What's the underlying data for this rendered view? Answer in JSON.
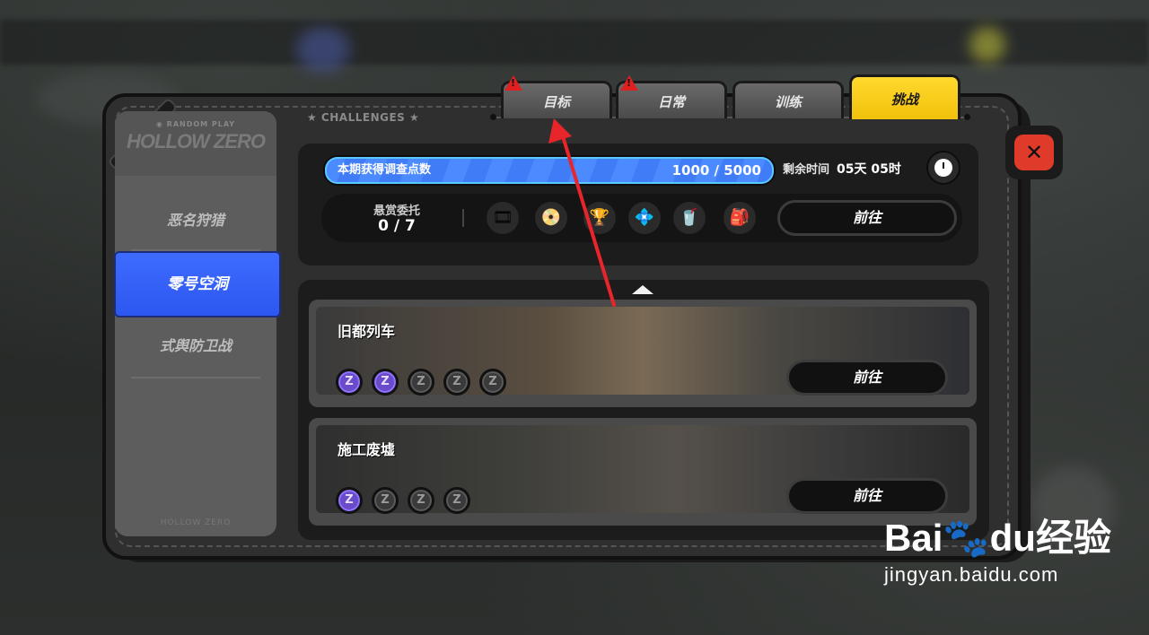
{
  "header": {
    "section_label": "★ CHALLENGES ★"
  },
  "tabs": [
    {
      "label": "目标",
      "alert": true,
      "active": false
    },
    {
      "label": "日常",
      "alert": true,
      "active": false
    },
    {
      "label": "训练",
      "alert": false,
      "active": false
    },
    {
      "label": "挑战",
      "alert": false,
      "active": true
    }
  ],
  "alert_glyph": "!",
  "sidebar": {
    "brand_small": "◉ RANDOM PLAY",
    "brand": "HOLLOW ZERO",
    "items": [
      {
        "label": "恶名狩猎",
        "active": false
      },
      {
        "label": "零号空洞",
        "active": true
      },
      {
        "label": "式舆防卫战",
        "active": false
      }
    ],
    "footer": "HOLLOW ZERO"
  },
  "progress": {
    "label": "本期获得调查点数",
    "value_text": "1000 / 5000",
    "fraction": 1.0
  },
  "remaining": {
    "label": "剩余时间",
    "value": "05天 05时"
  },
  "bounty": {
    "title": "悬赏委托",
    "count": "0 / 7",
    "go_label": "前往",
    "items": [
      "film-reel-icon",
      "film-canister-icon",
      "trophy-icon",
      "gem-icon",
      "drink-icon",
      "bag-icon"
    ]
  },
  "stages": [
    {
      "title": "旧都列车",
      "go_label": "前往",
      "coins_total": 5,
      "coins_earned": 2
    },
    {
      "title": "施工废墟",
      "go_label": "前往",
      "coins_total": 4,
      "coins_earned": 1
    }
  ],
  "close_glyph": "✕",
  "coin_glyph": "Z",
  "watermark": {
    "main_a": "Bai",
    "main_b": "du",
    "main_c": "经验",
    "sub": "jingyan.baidu.com"
  },
  "colors": {
    "accent_yellow": "#f2c20b",
    "accent_blue": "#2b56f0",
    "close_red": "#e03a2b",
    "arrow_red": "#e8252a"
  }
}
